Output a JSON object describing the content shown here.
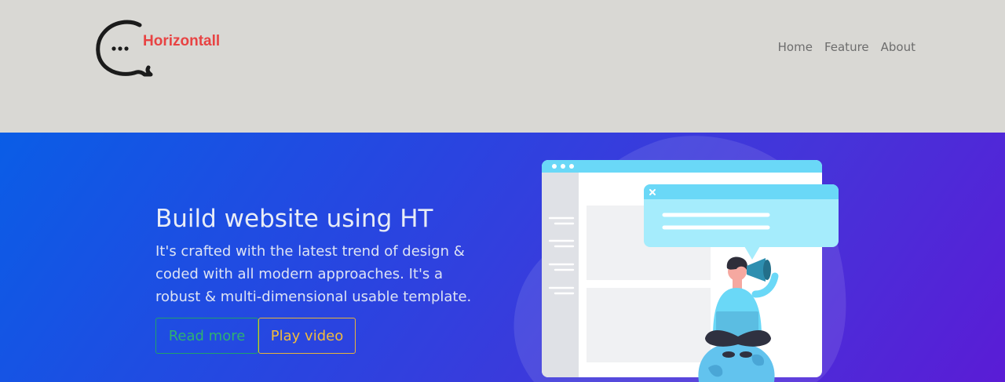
{
  "brand": {
    "name": "Horizontall",
    "logo_icon": "speech-bubble-icon"
  },
  "nav": {
    "items": [
      "Home",
      "Feature",
      "About"
    ]
  },
  "hero": {
    "title": "Build website using HT",
    "description": "It's crafted with the latest trend of design & coded with all modern approaches. It's a robust & multi-dimensional usable template.",
    "read_more_label": "Read more",
    "play_video_label": "Play video"
  },
  "colors": {
    "header_bg": "#d9d8d4",
    "brand_red": "#e84343",
    "hero_gradient_start": "#0a5de6",
    "hero_gradient_end": "#5a1cd6",
    "read_more": "#2fb170",
    "play_video": "#f2bb3c"
  }
}
